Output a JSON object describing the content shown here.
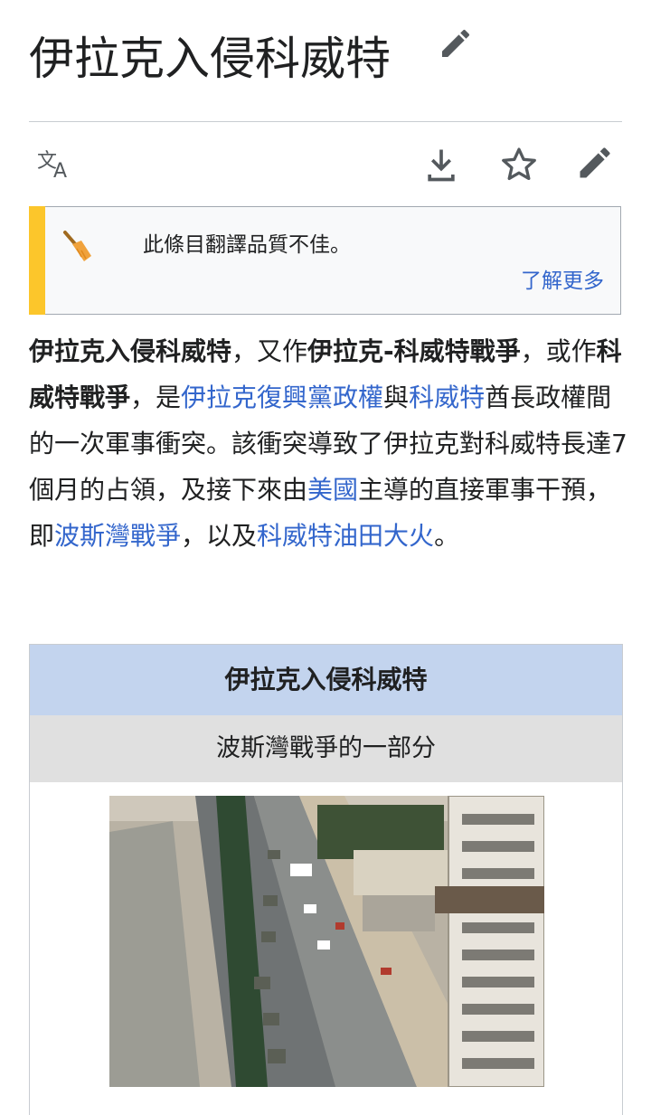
{
  "page": {
    "title": "伊拉克入侵科威特"
  },
  "toolbar": {
    "icons": [
      "translate-icon",
      "download-icon",
      "star-icon",
      "edit-icon"
    ]
  },
  "notice": {
    "message": "此條目翻譯品質不佳。",
    "learn_more": "了解更多",
    "accent_color": "#fcc62b"
  },
  "lead": {
    "t1": "伊拉克入侵科威特",
    "t2": "，又作",
    "t3": "伊拉克-科威特戰爭",
    "t4": "，或作",
    "t5": "科威特戰爭",
    "t6": "，是",
    "l1": "伊拉克復興黨政權",
    "t7": "與",
    "l2": "科威特",
    "t8": "酋長政權間的一次軍事衝突。該衝突導致了伊拉克對科威特長達7個月的占領，及接下來由",
    "l3": "美國",
    "t9": "主導的直接軍事干預，即",
    "l4": "波斯灣戰爭",
    "t10": "，以及",
    "l5": "科威特油田大火",
    "t11": "。"
  },
  "infobox": {
    "title": "伊拉克入侵科威特",
    "sub_link": "波斯灣戰爭",
    "sub_text": "的一部分",
    "header_color": "#c3d4ee"
  },
  "colors": {
    "link": "#3366cc",
    "text": "#202122"
  }
}
